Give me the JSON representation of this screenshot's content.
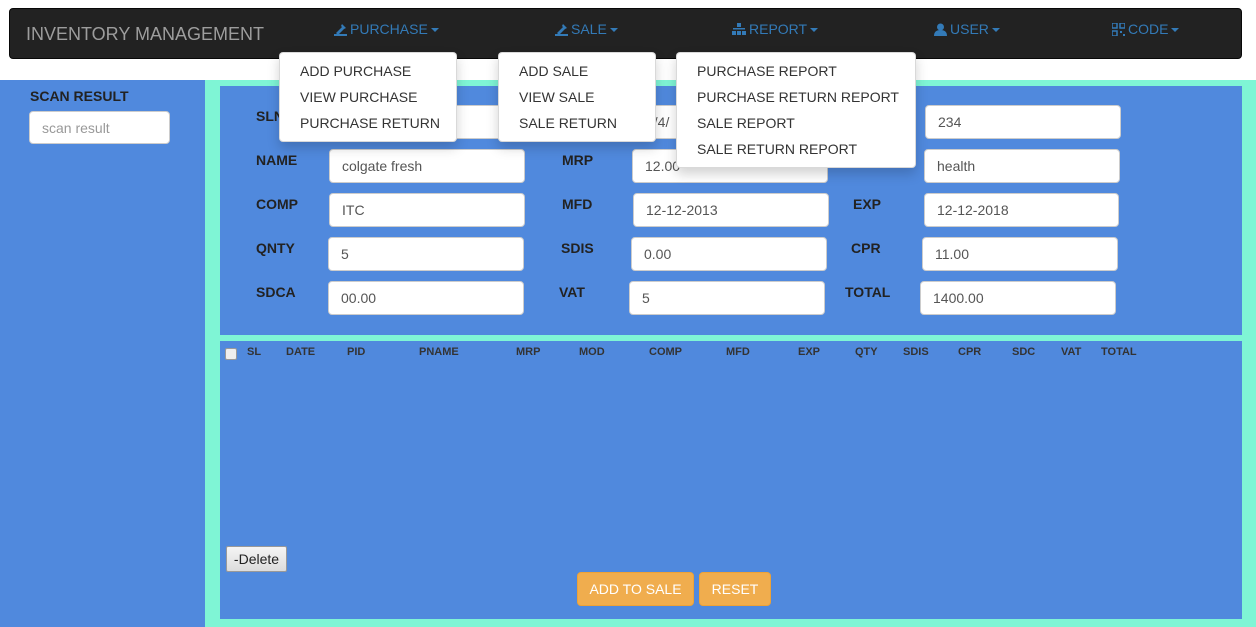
{
  "navbar": {
    "brand": "INVENTORY MANAGEMENT",
    "items": [
      {
        "label": "PURCHASE",
        "icon": "purchase-icon"
      },
      {
        "label": "SALE",
        "icon": "sale-icon"
      },
      {
        "label": "REPORT",
        "icon": "report-icon"
      },
      {
        "label": "USER",
        "icon": "user-icon"
      },
      {
        "label": "CODE",
        "icon": "qrcode-icon"
      }
    ]
  },
  "menus": {
    "purchase": [
      "ADD PURCHASE",
      "VIEW PURCHASE",
      "PURCHASE RETURN"
    ],
    "sale": [
      "ADD SALE",
      "VIEW SALE",
      "SALE RETURN"
    ],
    "report": [
      "PURCHASE REPORT",
      "PURCHASE RETURN REPORT",
      "SALE REPORT",
      "SALE RETURN REPORT"
    ]
  },
  "scan": {
    "label": "SCAN RESULT",
    "placeholder": "scan result"
  },
  "form": {
    "sln_label": "SLN",
    "date_value": "9/4/",
    "pid_value": "234",
    "name_label": "NAME",
    "name_value": "colgate fresh",
    "mrp_label": "MRP",
    "mrp_value": "12.00",
    "category_value": "health",
    "comp_label": "COMP",
    "comp_value": "ITC",
    "mfd_label": "MFD",
    "mfd_value": "12-12-2013",
    "exp_label": "EXP",
    "exp_value": "12-12-2018",
    "qnty_label": "QNTY",
    "qnty_value": "5",
    "sdis_label": "SDIS",
    "sdis_value": "0.00",
    "cpr_label": "CPR",
    "cpr_value": "11.00",
    "sdca_label": "SDCA",
    "sdca_value": "00.00",
    "vat_label": "VAT",
    "vat_value": "5",
    "total_label": "TOTAL",
    "total_value": "1400.00"
  },
  "table": {
    "columns": [
      "SL",
      "DATE",
      "PID",
      "PNAME",
      "MRP",
      "MOD",
      "COMP",
      "MFD",
      "EXP",
      "QTY",
      "SDIS",
      "CPR",
      "SDC",
      "VAT",
      "TOTAL"
    ]
  },
  "buttons": {
    "delete": "-Delete",
    "add_to_sale": "ADD TO SALE",
    "reset": "RESET"
  },
  "colors": {
    "panel": "#5089dd",
    "frame": "#7ff5d5",
    "navbar": "#222222",
    "link": "#337ab7",
    "warning": "#f0ad4e"
  }
}
